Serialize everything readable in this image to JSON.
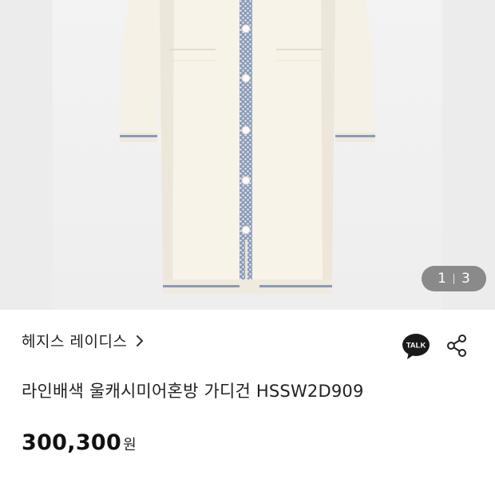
{
  "gallery": {
    "current_page": "1",
    "total_pages": "3",
    "colors": {
      "background": "#ececec",
      "garment": "#f5f1e6",
      "placket": "#8b9bb6"
    }
  },
  "product": {
    "brand": "헤지스 레이디스",
    "title": "라인배색 울캐시미어혼방 가디건 HSSW2D909",
    "price": "300,300",
    "currency": "원"
  },
  "actions": {
    "talk_label": "TALK",
    "talk_icon": "kakaotalk-icon",
    "share_icon": "share-icon",
    "brand_link_icon": "chevron-right-icon"
  }
}
